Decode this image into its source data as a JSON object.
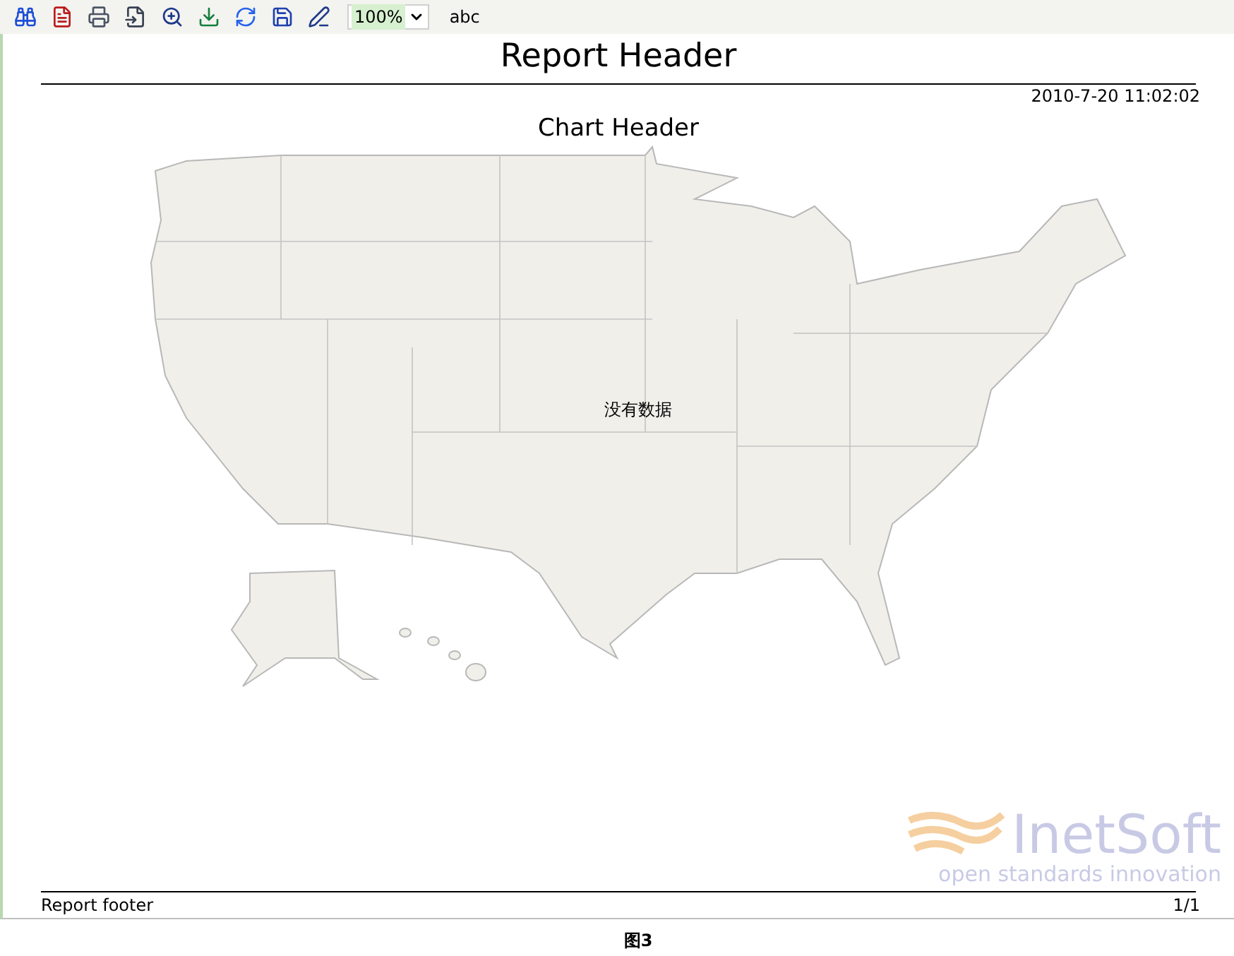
{
  "toolbar": {
    "zoom": "100%",
    "find": "abc"
  },
  "report": {
    "header": "Report Header",
    "timestamp": "2010-7-20 11:02:02",
    "chart_header": "Chart Header",
    "map_message": "没有数据",
    "footer": "Report footer",
    "page": "1/1"
  },
  "logo": {
    "name": "InetSoft",
    "tagline": "open standards innovation"
  },
  "caption": "图3"
}
